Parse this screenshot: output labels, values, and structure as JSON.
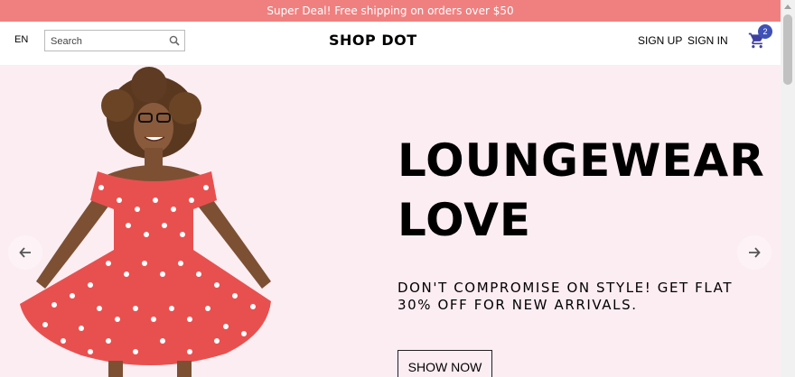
{
  "promo": {
    "text": "Super Deal! Free shipping on orders over $50"
  },
  "header": {
    "language": "EN",
    "search_placeholder": "Search",
    "logo": "SHOP DOT",
    "sign_up": "SIGN UP",
    "sign_in": "SIGN IN",
    "cart_count": "2"
  },
  "hero": {
    "title_line1": "LOUNGEWEAR",
    "title_line2": "LOVE",
    "subtitle_line1": "Don't compromise on style! Get flat",
    "subtitle_line2": "30% off for New Arrivals.",
    "cta": "SHOW NOW"
  },
  "colors": {
    "promo_bg": "#f08080",
    "hero_bg": "#fcedf2",
    "badge": "#3f51b5",
    "dress": "#e8504f"
  },
  "icons": [
    "search-icon",
    "cart-icon",
    "arrow-left-icon",
    "arrow-right-icon"
  ]
}
